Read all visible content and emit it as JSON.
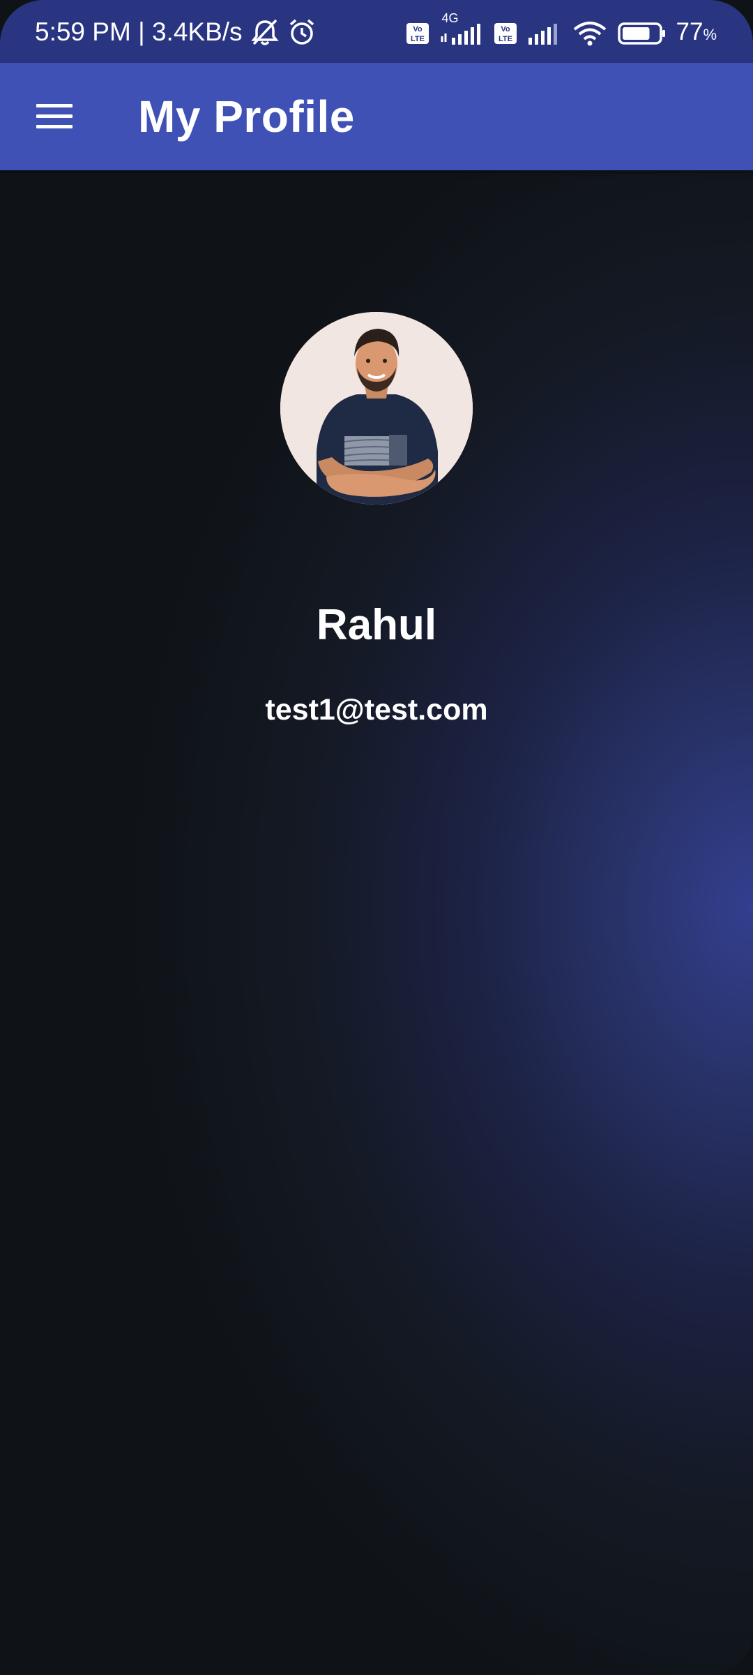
{
  "status_bar": {
    "time_speed": "5:59 PM | 3.4KB/s",
    "network_type": "4G",
    "battery_percent": "77",
    "battery_unit": "%",
    "battery_level": 0.77,
    "icons": [
      "mute-icon",
      "alarm-icon",
      "volte-icon",
      "signal-icon",
      "wifi-icon",
      "battery-icon"
    ]
  },
  "app_bar": {
    "title": "My Profile",
    "menu_icon": "hamburger-menu-icon"
  },
  "profile": {
    "name": "Rahul",
    "email": "test1@test.com"
  },
  "colors": {
    "status_bar": "#2a3582",
    "app_bar": "#3f51b5",
    "background_dark": "#0f1317",
    "background_accent": "#333f8f",
    "text": "#ffffff"
  }
}
